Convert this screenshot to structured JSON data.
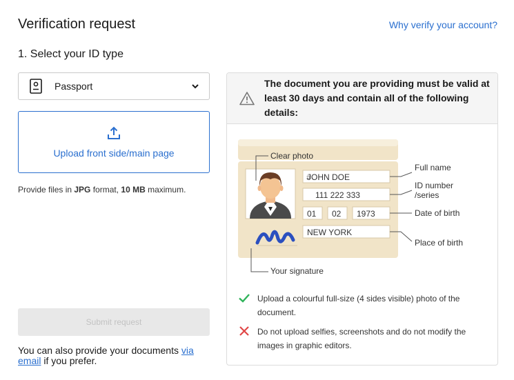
{
  "header": {
    "title": "Verification request",
    "why_link": "Why verify your account?"
  },
  "step": {
    "title": "1. Select your ID type"
  },
  "id_select": {
    "selected": "Passport",
    "icon": "passport-icon"
  },
  "upload": {
    "label": "Upload front side/main page",
    "icon": "upload-icon"
  },
  "hint": {
    "prefix": "Provide files in ",
    "format": "JPG",
    "middle": " format, ",
    "size": "10 MB",
    "suffix": " maximum."
  },
  "submit": {
    "label": "Submit request",
    "enabled": false
  },
  "alternative": {
    "prefix": "You can also provide your documents ",
    "link": "via email",
    "suffix": " if you prefer."
  },
  "requirements": {
    "heading": "The document you are providing must be valid at least 30 days and contain all of the following details:",
    "illustration": {
      "name": "JOHN DOE",
      "id_number": "111 222 333",
      "dob_day": "01",
      "dob_month": "02",
      "dob_year": "1973",
      "place": "NEW YORK",
      "labels": {
        "clear_photo": "Clear photo",
        "full_name": "Full name",
        "id_number_line1": "ID number",
        "id_number_line2": "/series",
        "date_of_birth": "Date of birth",
        "place_of_birth": "Place of birth",
        "signature": "Your signature"
      }
    },
    "rules": [
      {
        "type": "do",
        "icon": "check-icon",
        "text": "Upload a colourful full-size (4 sides visible) photo of the document."
      },
      {
        "type": "dont",
        "icon": "cross-icon",
        "text": "Do not upload selfies, screenshots and do not modify the images in graphic editors."
      }
    ]
  },
  "colors": {
    "accent": "#2a6fcf",
    "success": "#2fb35a",
    "error": "#e04646",
    "card": "#f1e4c8"
  }
}
